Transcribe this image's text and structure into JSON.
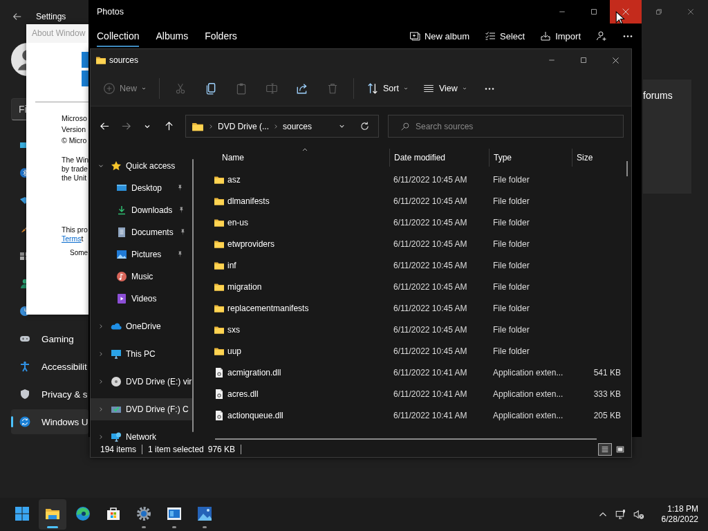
{
  "settings": {
    "title": "Settings",
    "search": {
      "placeholder": "Fi"
    },
    "nav_items": [
      {
        "kind": "system",
        "selected": false
      },
      {
        "kind": "bluetooth",
        "selected": false
      },
      {
        "kind": "network",
        "selected": false
      },
      {
        "kind": "personalization",
        "selected": false
      },
      {
        "kind": "apps",
        "selected": false
      },
      {
        "kind": "accounts",
        "selected": false
      },
      {
        "kind": "time",
        "selected": false
      },
      {
        "kind": "gaming",
        "label": "Gaming",
        "selected": false
      },
      {
        "kind": "accessibility",
        "label": "Accessibilit",
        "selected": false
      },
      {
        "kind": "privacy",
        "label": "Privacy & s",
        "selected": false
      },
      {
        "kind": "update",
        "label": "Windows U",
        "selected": true
      }
    ],
    "panel_text": "forums"
  },
  "about_dialog": {
    "title": "About Window",
    "paragraphs": [
      [
        "Microso",
        "Version",
        "© Micro"
      ],
      [
        "The Win",
        "by trade",
        "the Unit"
      ]
    ],
    "license": {
      "text": "This pro",
      "link": "Terms",
      "link_tail": "t"
    },
    "footer": "Some"
  },
  "photos": {
    "title": "Photos",
    "close_hovered": true,
    "tabs": [
      {
        "label": "Collection",
        "selected": true
      },
      {
        "label": "Albums",
        "selected": false
      },
      {
        "label": "Folders",
        "selected": false
      }
    ],
    "actions": [
      {
        "kind": "new-album",
        "label": "New album"
      },
      {
        "kind": "select",
        "label": "Select"
      },
      {
        "kind": "import",
        "label": "Import"
      },
      {
        "kind": "account"
      },
      {
        "kind": "more"
      }
    ]
  },
  "explorer": {
    "title": "sources",
    "toolbar": [
      {
        "kind": "new",
        "label": "New",
        "disabled": true
      },
      {
        "kind": "cut",
        "disabled": true
      },
      {
        "kind": "copy",
        "disabled": false
      },
      {
        "kind": "paste",
        "disabled": true
      },
      {
        "kind": "rename",
        "disabled": true
      },
      {
        "kind": "share",
        "disabled": false
      },
      {
        "kind": "delete",
        "disabled": true
      },
      {
        "kind": "sort",
        "label": "Sort",
        "disabled": false
      },
      {
        "kind": "view",
        "label": "View",
        "disabled": false
      },
      {
        "kind": "more",
        "disabled": false
      }
    ],
    "nav_buttons": [
      {
        "kind": "back",
        "disabled": false
      },
      {
        "kind": "forward",
        "disabled": true
      },
      {
        "kind": "recent",
        "disabled": false
      },
      {
        "kind": "up",
        "disabled": false
      }
    ],
    "breadcrumb": [
      "DVD Drive (...",
      "sources"
    ],
    "search": {
      "placeholder": "Search sources"
    },
    "nav": [
      {
        "kind": "star",
        "label": "Quick access",
        "expanded": true,
        "selected": false,
        "children": [
          {
            "kind": "desktop",
            "label": "Desktop",
            "pinned": true,
            "selected": false
          },
          {
            "kind": "download",
            "label": "Downloads",
            "pinned": true,
            "selected": false
          },
          {
            "kind": "documents",
            "label": "Documents",
            "pinned": true,
            "selected": false
          },
          {
            "kind": "pictures",
            "label": "Pictures",
            "pinned": true,
            "selected": false
          },
          {
            "kind": "music",
            "label": "Music",
            "pinned": false,
            "selected": false
          },
          {
            "kind": "videos",
            "label": "Videos",
            "pinned": false,
            "selected": false
          }
        ]
      },
      {
        "kind": "onedrive",
        "label": "OneDrive",
        "expanded": false,
        "selected": false
      },
      {
        "kind": "pc",
        "label": "This PC",
        "expanded": false,
        "selected": false
      },
      {
        "kind": "dvd",
        "label": "DVD Drive (E:) vir",
        "expanded": false,
        "selected": false
      },
      {
        "kind": "dvdinstall",
        "label": "DVD Drive (F:) C",
        "expanded": false,
        "selected": true
      },
      {
        "kind": "network",
        "label": "Network",
        "expanded": false,
        "selected": false
      }
    ],
    "columns": [
      "Name",
      "Date modified",
      "Type",
      "Size"
    ],
    "files": [
      {
        "kind": "folder",
        "name": "asz",
        "date": "6/11/2022 10:45 AM",
        "type": "File folder"
      },
      {
        "kind": "folder",
        "name": "dlmanifests",
        "date": "6/11/2022 10:45 AM",
        "type": "File folder"
      },
      {
        "kind": "folder",
        "name": "en-us",
        "date": "6/11/2022 10:45 AM",
        "type": "File folder"
      },
      {
        "kind": "folder",
        "name": "etwproviders",
        "date": "6/11/2022 10:45 AM",
        "type": "File folder"
      },
      {
        "kind": "folder",
        "name": "inf",
        "date": "6/11/2022 10:45 AM",
        "type": "File folder"
      },
      {
        "kind": "folder",
        "name": "migration",
        "date": "6/11/2022 10:45 AM",
        "type": "File folder"
      },
      {
        "kind": "folder",
        "name": "replacementmanifests",
        "date": "6/11/2022 10:45 AM",
        "type": "File folder"
      },
      {
        "kind": "folder",
        "name": "sxs",
        "date": "6/11/2022 10:45 AM",
        "type": "File folder"
      },
      {
        "kind": "folder",
        "name": "uup",
        "date": "6/11/2022 10:45 AM",
        "type": "File folder"
      },
      {
        "kind": "dll",
        "name": "acmigration.dll",
        "date": "6/11/2022 10:41 AM",
        "type": "Application exten...",
        "size": "541 KB"
      },
      {
        "kind": "dll",
        "name": "acres.dll",
        "date": "6/11/2022 10:41 AM",
        "type": "Application exten...",
        "size": "333 KB"
      },
      {
        "kind": "dll",
        "name": "actionqueue.dll",
        "date": "6/11/2022 10:41 AM",
        "type": "Application exten...",
        "size": "205 KB"
      }
    ],
    "status": {
      "count": "194 items",
      "selection": "1 item selected",
      "size": "976 KB"
    },
    "views": [
      {
        "kind": "details",
        "selected": true
      },
      {
        "kind": "tiles",
        "selected": false
      }
    ]
  },
  "taskbar": {
    "apps": [
      {
        "kind": "start",
        "selected": false,
        "running": false
      },
      {
        "kind": "explorer",
        "selected": true,
        "running": true
      },
      {
        "kind": "edge",
        "selected": false,
        "running": false
      },
      {
        "kind": "store",
        "selected": false,
        "running": false
      },
      {
        "kind": "settings",
        "selected": false,
        "running": true
      },
      {
        "kind": "app",
        "selected": false,
        "running": true
      },
      {
        "kind": "photos",
        "selected": false,
        "running": true
      }
    ],
    "tray": [
      {
        "kind": "chevron"
      },
      {
        "kind": "network"
      },
      {
        "kind": "volume-muted"
      }
    ],
    "clock": {
      "time": "1:18 PM",
      "date": "6/28/2022"
    }
  }
}
